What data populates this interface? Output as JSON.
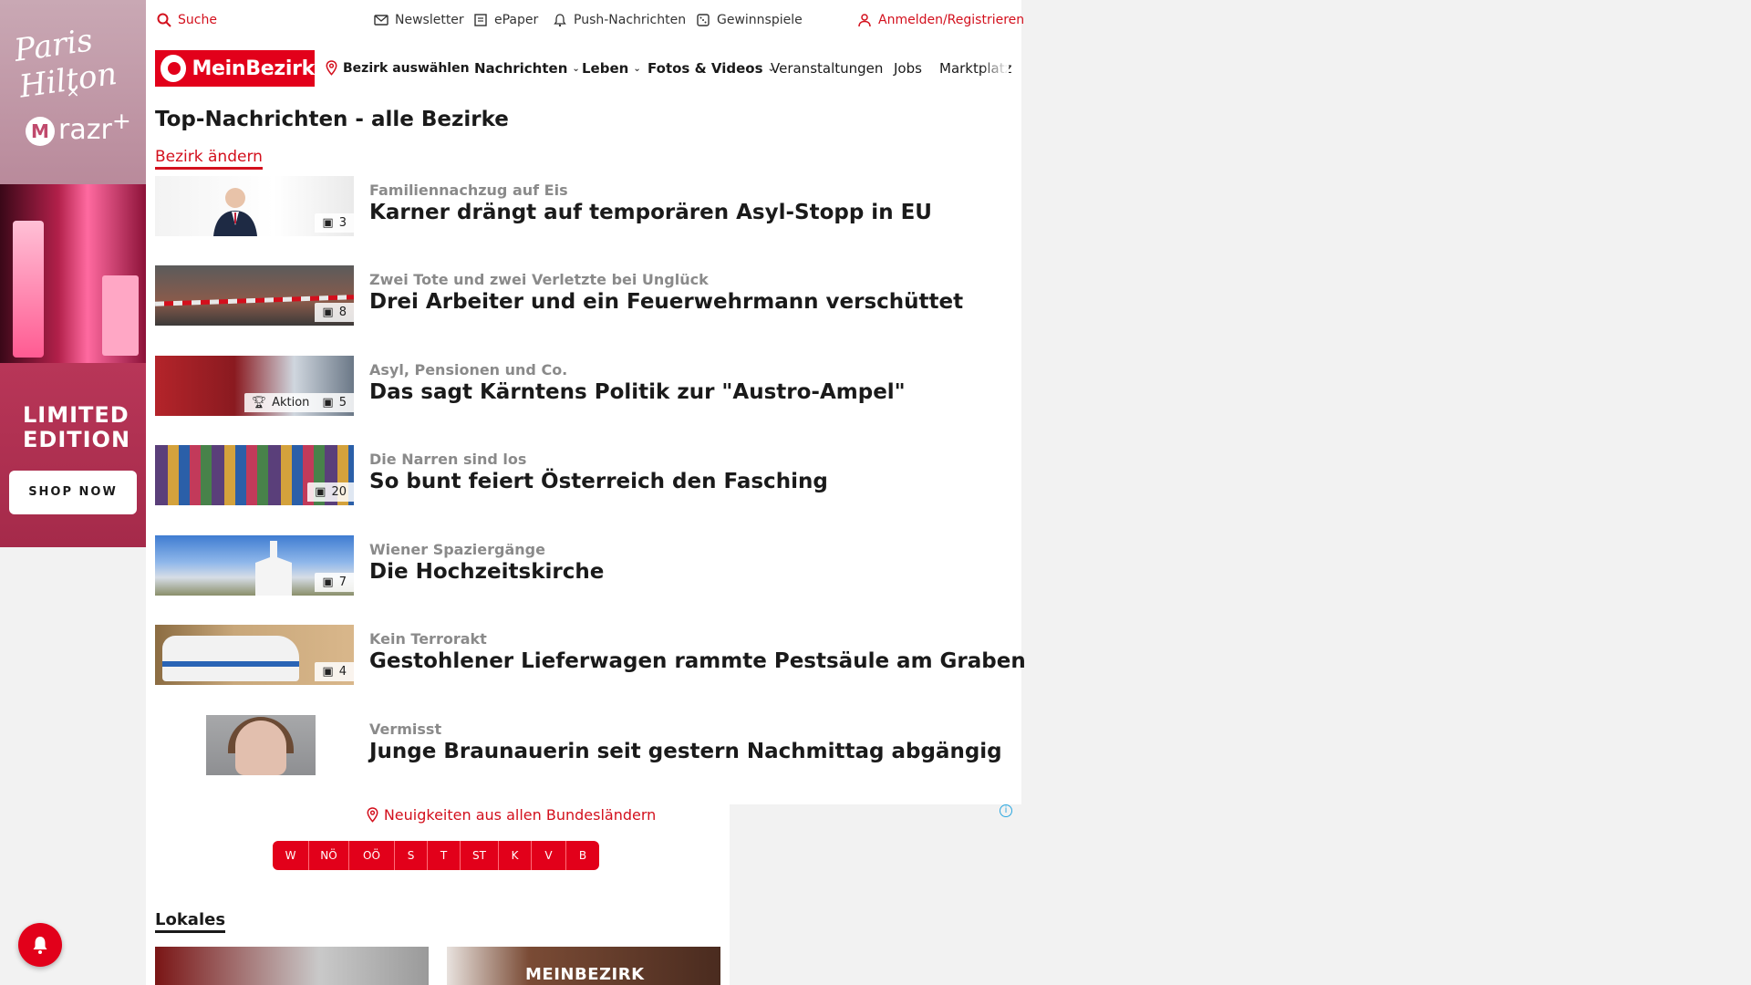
{
  "ad_left": {
    "brand1": "Paris Hilton",
    "x": "×",
    "brand2": "razr",
    "brand2_mark": "M",
    "limited": "LIMITED EDITION",
    "cta": "SHOP NOW"
  },
  "utilbar": {
    "search": "Suche",
    "newsletter": "Newsletter",
    "epaper": "ePaper",
    "push": "Push-Nachrichten",
    "gewinnspiele": "Gewinnspiele",
    "login": "Anmelden/Registrieren"
  },
  "nav": {
    "logo": "MeinBezirk",
    "bezirk": "Bezirk auswählen",
    "items": [
      {
        "label": "Nachrichten",
        "dropdown": true
      },
      {
        "label": "Leben",
        "dropdown": true
      },
      {
        "label": "Fotos & Videos",
        "dropdown": true
      },
      {
        "label": "Veranstaltungen",
        "dropdown": false
      },
      {
        "label": "Jobs",
        "dropdown": false
      },
      {
        "label": "Marktplatz",
        "dropdown": false
      }
    ]
  },
  "main": {
    "title": "Top-Nachrichten - alle Bezirke",
    "change_link": "Bezirk ändern",
    "articles": [
      {
        "kicker": "Familiennachzug auf Eis",
        "headline": "Karner drängt auf temporären Asyl-Stopp in EU",
        "images": "3"
      },
      {
        "kicker": "Zwei Tote und zwei Verletzte bei Unglück",
        "headline": "Drei Arbeiter und ein Feuerwehrmann verschüttet",
        "images": "8"
      },
      {
        "kicker": "Asyl, Pensionen und Co.",
        "headline": "Das sagt Kärntens Politik zur \"Austro-Ampel\"",
        "images": "5",
        "badge": "Aktion"
      },
      {
        "kicker": "Die Narren sind los",
        "headline": "So bunt feiert Österreich den Fasching",
        "images": "20"
      },
      {
        "kicker": "Wiener Spaziergänge",
        "headline": "Die Hochzeitskirche",
        "images": "7"
      },
      {
        "kicker": "Kein Terrorakt",
        "headline": "Gestohlener Lieferwagen rammte Pestsäule am Graben",
        "images": "4"
      },
      {
        "kicker": "Vermisst",
        "headline": "Junge Braunauerin seit gestern Nachmittag abgängig"
      }
    ]
  },
  "bundeslaender": {
    "title": "Neuigkeiten aus allen Bundesländern",
    "buttons": [
      "W",
      "NÖ",
      "OÖ",
      "S",
      "T",
      "ST",
      "K",
      "V",
      "B"
    ]
  },
  "lokales": {
    "title": "Lokales",
    "card2_text": "MEINBEZIRK"
  },
  "colors": {
    "brand_red": "#e2001a",
    "text_dark": "#1a1a1a",
    "kicker_gray": "#8a8a8a"
  }
}
